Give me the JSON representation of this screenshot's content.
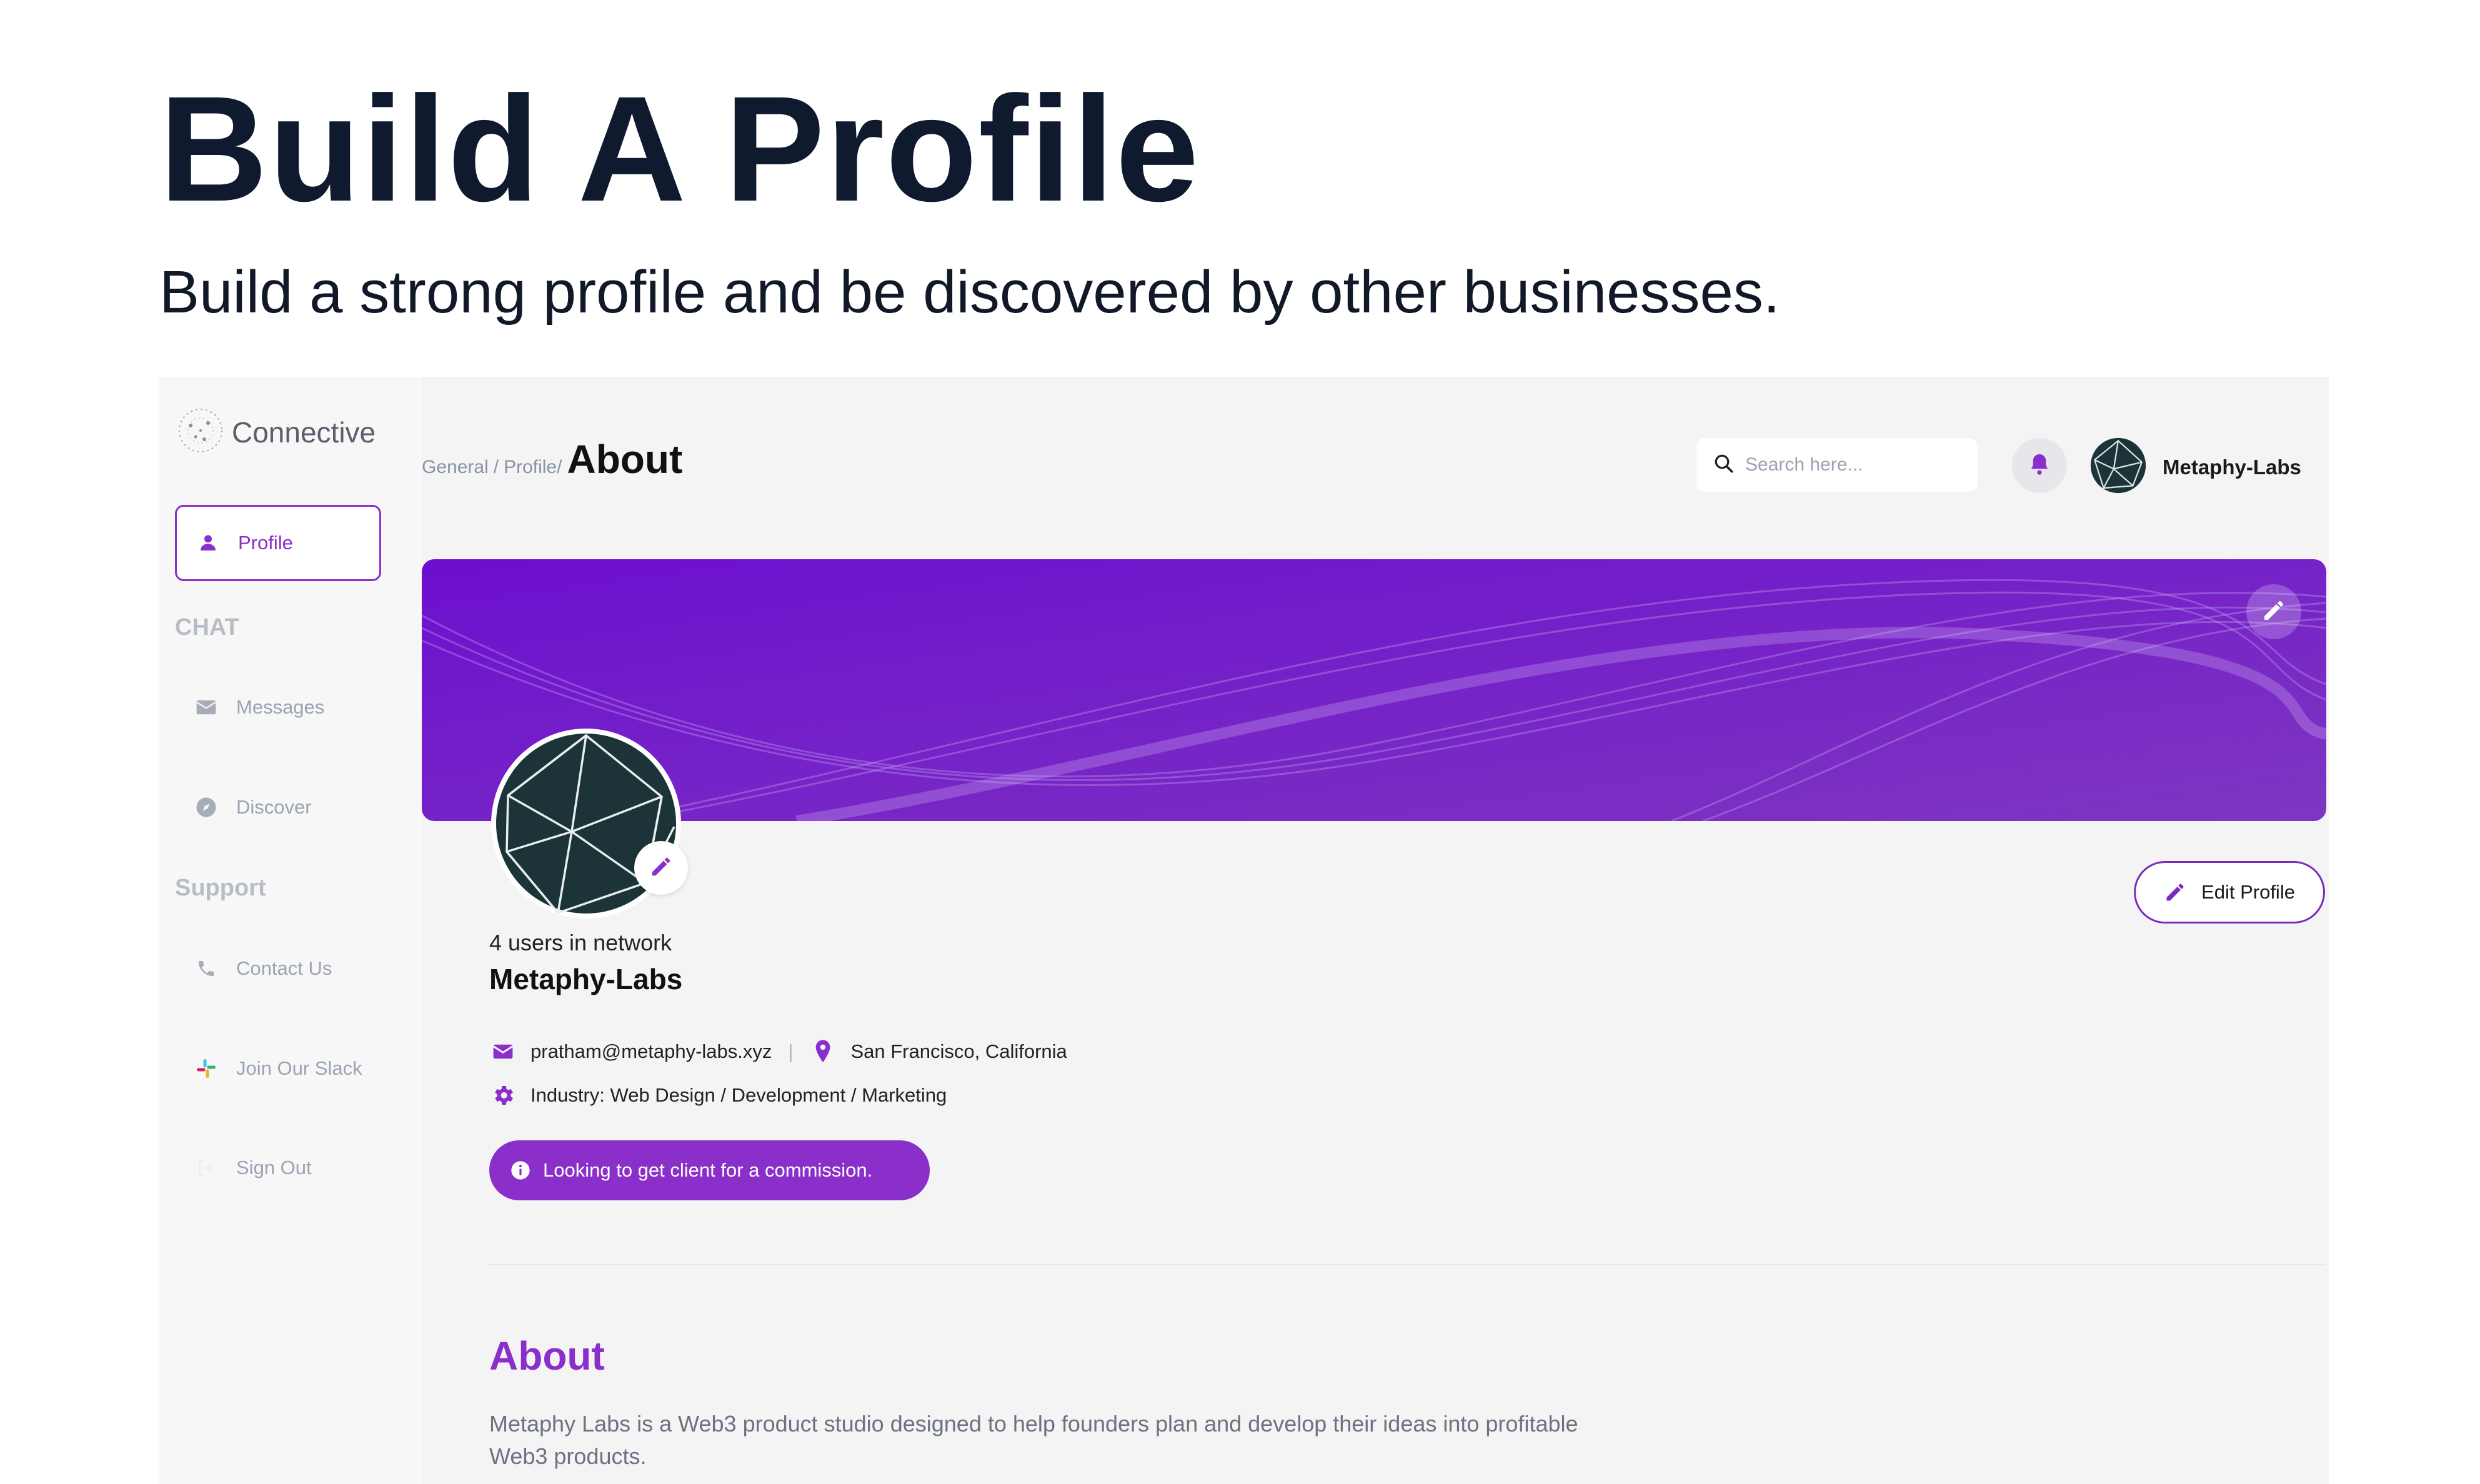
{
  "hero": {
    "title": "Build A Profile",
    "subtitle": "Build a strong profile and be discovered by other businesses."
  },
  "sidebar": {
    "logo_text": "Connective",
    "profile_label": "Profile",
    "chat_section": "CHAT",
    "messages_label": "Messages",
    "discover_label": "Discover",
    "support_section": "Support",
    "contact_label": "Contact Us",
    "slack_label": "Join Our Slack",
    "signout_label": "Sign Out"
  },
  "header": {
    "breadcrumb_general": "General",
    "breadcrumb_sep1": "/",
    "breadcrumb_profile": "Profile",
    "breadcrumb_sep2": "/",
    "breadcrumb_current": "About",
    "search_placeholder": "Search here...",
    "user_name": "Metaphy-Labs"
  },
  "profile": {
    "network_text": "4 users in network",
    "name": "Metaphy-Labs",
    "email": "pratham@metaphy-labs.xyz",
    "separator": "|",
    "location": "San Francisco, California",
    "industry": "Industry: Web Design / Development / Marketing",
    "status_pill": "Looking to get client for a commission.",
    "edit_button": "Edit Profile"
  },
  "about": {
    "heading": "About",
    "text": "Metaphy Labs is a Web3 product studio designed to help founders plan and develop their ideas into profitable Web3 products."
  },
  "colors": {
    "accent": "#8a2fc9",
    "banner_start": "#6c0fcf",
    "banner_end": "#7e36c0",
    "avatar_bg": "#1c3338",
    "title_dark": "#0f1a2e"
  },
  "icons": {
    "logo": "network-globe-icon",
    "profile": "user-icon",
    "messages": "envelope-icon",
    "discover": "compass-icon",
    "contact": "phone-icon",
    "slack": "slack-icon",
    "signout": "sign-out-icon",
    "search": "search-icon",
    "bell": "bell-icon",
    "edit": "pencil-icon",
    "email": "email-icon",
    "location": "map-pin-icon",
    "industry": "gear-icon",
    "info": "info-icon"
  }
}
